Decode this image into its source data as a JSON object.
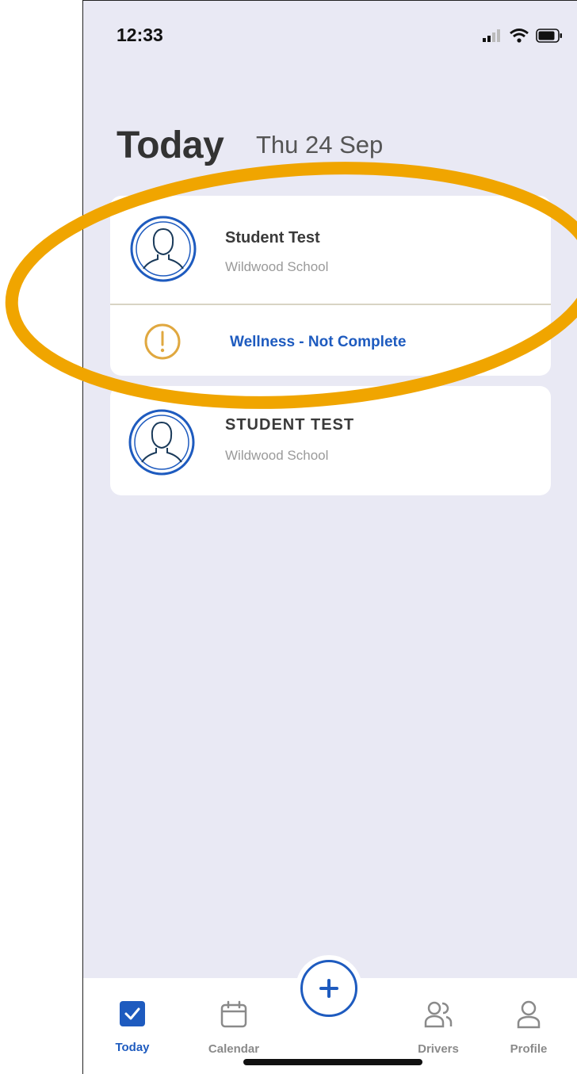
{
  "status_bar": {
    "time": "12:33"
  },
  "header": {
    "title": "Today",
    "date": "Thu 24 Sep"
  },
  "cards": [
    {
      "name": "Student Test",
      "school": "Wildwood School",
      "alert": "Wellness - Not Complete"
    },
    {
      "name": "STUDENT TEST",
      "school": "Wildwood School"
    }
  ],
  "tabs": {
    "today": "Today",
    "calendar": "Calendar",
    "drivers": "Drivers",
    "profile": "Profile"
  },
  "colors": {
    "accent": "#1e5bbf",
    "annotation": "#f0a500",
    "alert": "#e0a840"
  }
}
